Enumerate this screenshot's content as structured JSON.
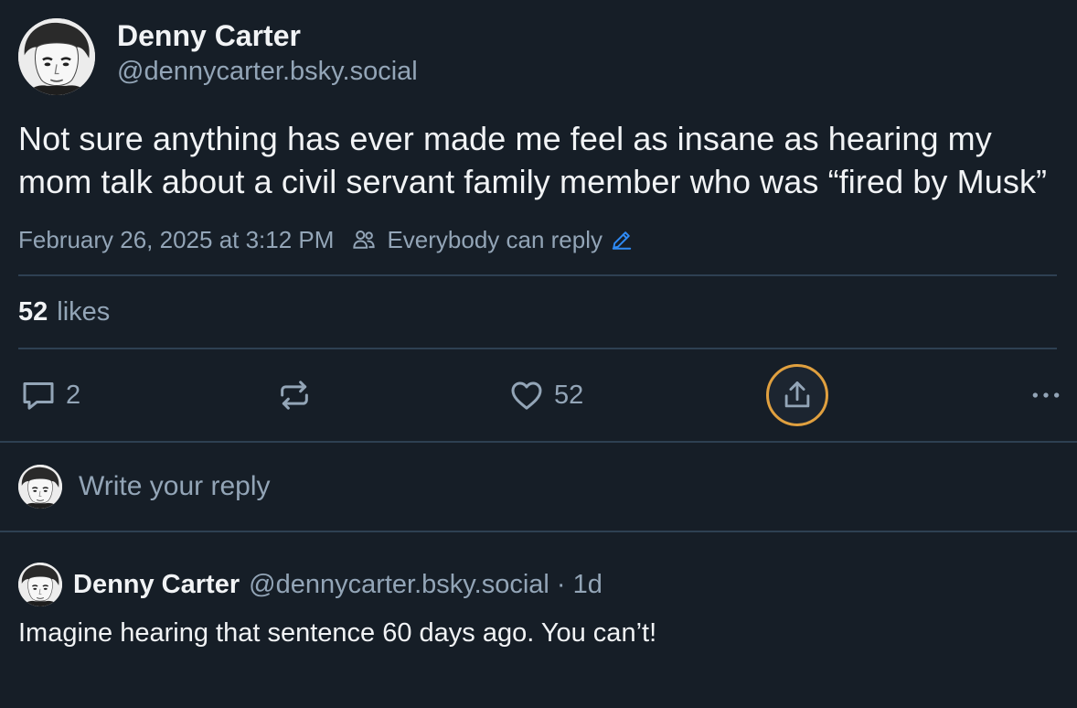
{
  "post": {
    "author_name": "Denny Carter",
    "author_handle": "@dennycarter.bsky.social",
    "text": "Not sure anything has ever made me feel as insane as hearing my mom talk about a civil servant family member who was “fired by Musk”",
    "timestamp": "February 26, 2025 at 3:12 PM",
    "reply_setting": "Everybody can reply",
    "likes_count": "52",
    "likes_label": "likes"
  },
  "actions": {
    "reply_count": "2",
    "like_count": "52"
  },
  "composer": {
    "placeholder": "Write your reply"
  },
  "reply": {
    "author_name": "Denny Carter",
    "author_handle": "@dennycarter.bsky.social",
    "separator": "·",
    "age": "1d",
    "text": "Imagine hearing that sentence 60 days ago. You can’t!"
  },
  "icons": {
    "reply": "speech-bubble-icon",
    "repost": "repost-icon",
    "like": "heart-icon",
    "share": "share-icon",
    "more": "ellipsis-icon",
    "audience": "people-icon",
    "edit": "pencil-icon"
  },
  "colors": {
    "background": "#161e27",
    "text": "#f1f3f5",
    "muted": "#93a5b7",
    "divider": "#2e4052",
    "accent": "#2f8bf6",
    "share_ring": "#e0a03f"
  }
}
